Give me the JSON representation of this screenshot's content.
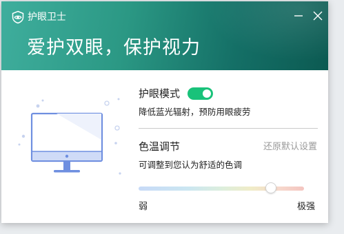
{
  "window": {
    "title": "护眼卫士",
    "slogan": "爱护双眼，保护视力",
    "icons": {
      "logo": "eye-shield-icon",
      "minimize": "minimize-icon",
      "close": "close-icon"
    }
  },
  "illustration": {
    "name": "monitor-illustration"
  },
  "eye_mode": {
    "label": "护眼模式",
    "enabled": true,
    "description": "降低蓝光辐射，预防用眼疲劳",
    "toggle_color": "#19c27a"
  },
  "color_temp": {
    "label": "色温调节",
    "reset_label": "还原默认设置",
    "description": "可调整到您认为舒适的色调",
    "min_label": "弱",
    "max_label": "极强",
    "value_fraction": 0.8
  },
  "colors": {
    "header_start": "#3fae9d",
    "header_end": "#0c5a52",
    "accent": "#19c27a"
  }
}
